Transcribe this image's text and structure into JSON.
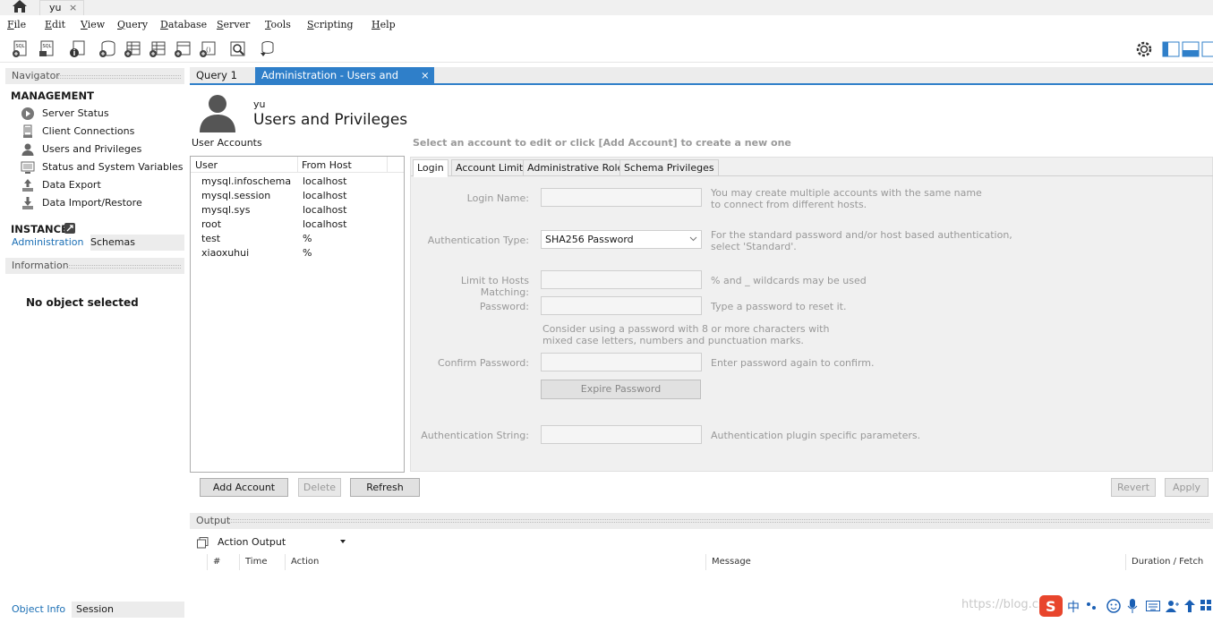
{
  "topbar": {
    "connection_tab": "yu",
    "close_glyph": "×"
  },
  "menu": [
    "File",
    "Edit",
    "View",
    "Query",
    "Database",
    "Server",
    "Tools",
    "Scripting",
    "Help"
  ],
  "navigator": {
    "title": "Navigator",
    "management_title": "MANAGEMENT",
    "management_items": [
      "Server Status",
      "Client Connections",
      "Users and Privileges",
      "Status and System Variables",
      "Data Export",
      "Data Import/Restore"
    ],
    "instance_title": "INSTANCE",
    "tabs": [
      "Administration",
      "Schemas"
    ],
    "information_title": "Information",
    "no_object": "No object selected",
    "bottom_tabs": [
      "Object Info",
      "Session"
    ]
  },
  "doc_tabs": [
    "Query 1",
    "Administration - Users and Privil..."
  ],
  "header": {
    "connection": "yu",
    "title": "Users and Privileges"
  },
  "accounts": {
    "label": "User Accounts",
    "columns": [
      "User",
      "From Host"
    ],
    "rows": [
      [
        "mysql.infoschema",
        "localhost"
      ],
      [
        "mysql.session",
        "localhost"
      ],
      [
        "mysql.sys",
        "localhost"
      ],
      [
        "root",
        "localhost"
      ],
      [
        "test",
        "%"
      ],
      [
        "xiaoxuhui",
        "%"
      ]
    ]
  },
  "form": {
    "hint": "Select an account to edit or click [Add Account] to create a new one",
    "tabs": [
      "Login",
      "Account Limits",
      "Administrative Roles",
      "Schema Privileges"
    ],
    "login_name_label": "Login Name:",
    "login_name_note": [
      "You may create multiple accounts with the same name",
      "to connect from different hosts."
    ],
    "auth_type_label": "Authentication Type:",
    "auth_type_value": "SHA256 Password",
    "auth_type_note": [
      "For the standard password and/or host based authentication,",
      "select 'Standard'."
    ],
    "hosts_label": "Limit to Hosts Matching:",
    "hosts_note": "% and _ wildcards may be used",
    "password_label": "Password:",
    "password_note": "Type a password to reset it.",
    "password_advice": [
      "Consider using a password with 8 or more characters with",
      "mixed case letters, numbers and punctuation marks."
    ],
    "confirm_label": "Confirm Password:",
    "confirm_note": "Enter password again to confirm.",
    "expire_button": "Expire Password",
    "auth_string_label": "Authentication String:",
    "auth_string_note": "Authentication plugin specific parameters."
  },
  "buttons": {
    "add": "Add Account",
    "delete": "Delete",
    "refresh": "Refresh",
    "revert": "Revert",
    "apply": "Apply"
  },
  "output": {
    "title": "Output",
    "selector": "Action Output",
    "columns": [
      "#",
      "Time",
      "Action",
      "Message",
      "Duration / Fetch"
    ]
  },
  "watermark": "https://blog.cs",
  "tray": {
    "ime_label": "中"
  },
  "colors": {
    "accent": "#2f7fc9",
    "link": "#1b6fb5",
    "panel": "#f0f0f0"
  }
}
